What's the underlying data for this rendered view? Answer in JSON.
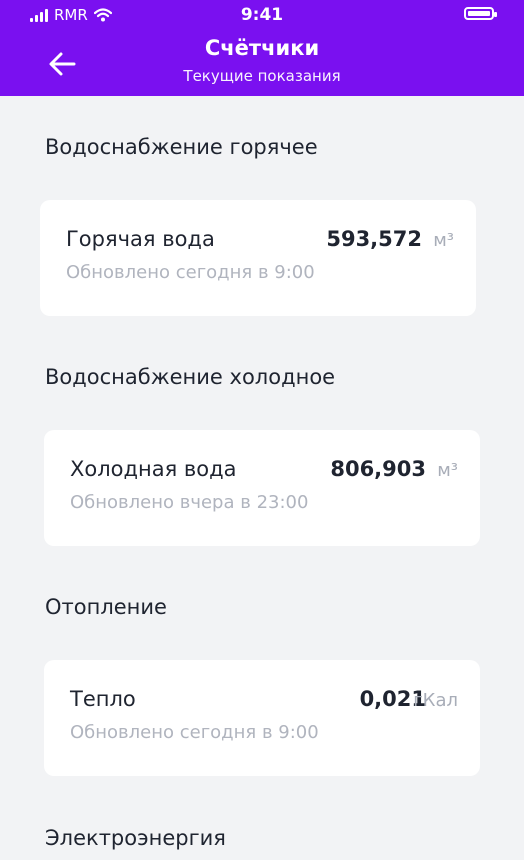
{
  "status_bar": {
    "carrier": "RMR",
    "time": "9:41",
    "signal_icon": "signal-bars-icon",
    "wifi_icon": "wifi-icon",
    "battery_icon": "battery-icon"
  },
  "header": {
    "back_icon": "arrow-left-icon",
    "title": "Счётчики",
    "subtitle": "Текущие показания",
    "background_color": "#7a10f0"
  },
  "sections": [
    {
      "title": "Водоснабжение горячее",
      "meter": {
        "name": "Горячая вода",
        "value": "593,572",
        "unit": "м³",
        "updated": "Обновлено сегодня в 9:00"
      }
    },
    {
      "title": "Водоснабжение холодное",
      "meter": {
        "name": "Холодная вода",
        "value": "806,903",
        "unit": "м³",
        "updated": "Обновлено вчера в 23:00"
      }
    },
    {
      "title": "Отопление",
      "meter": {
        "name": "Тепло",
        "value": "0,021",
        "unit": "гКал",
        "updated": "Обновлено сегодня в 9:00"
      }
    },
    {
      "title": "Электроэнергия"
    }
  ]
}
